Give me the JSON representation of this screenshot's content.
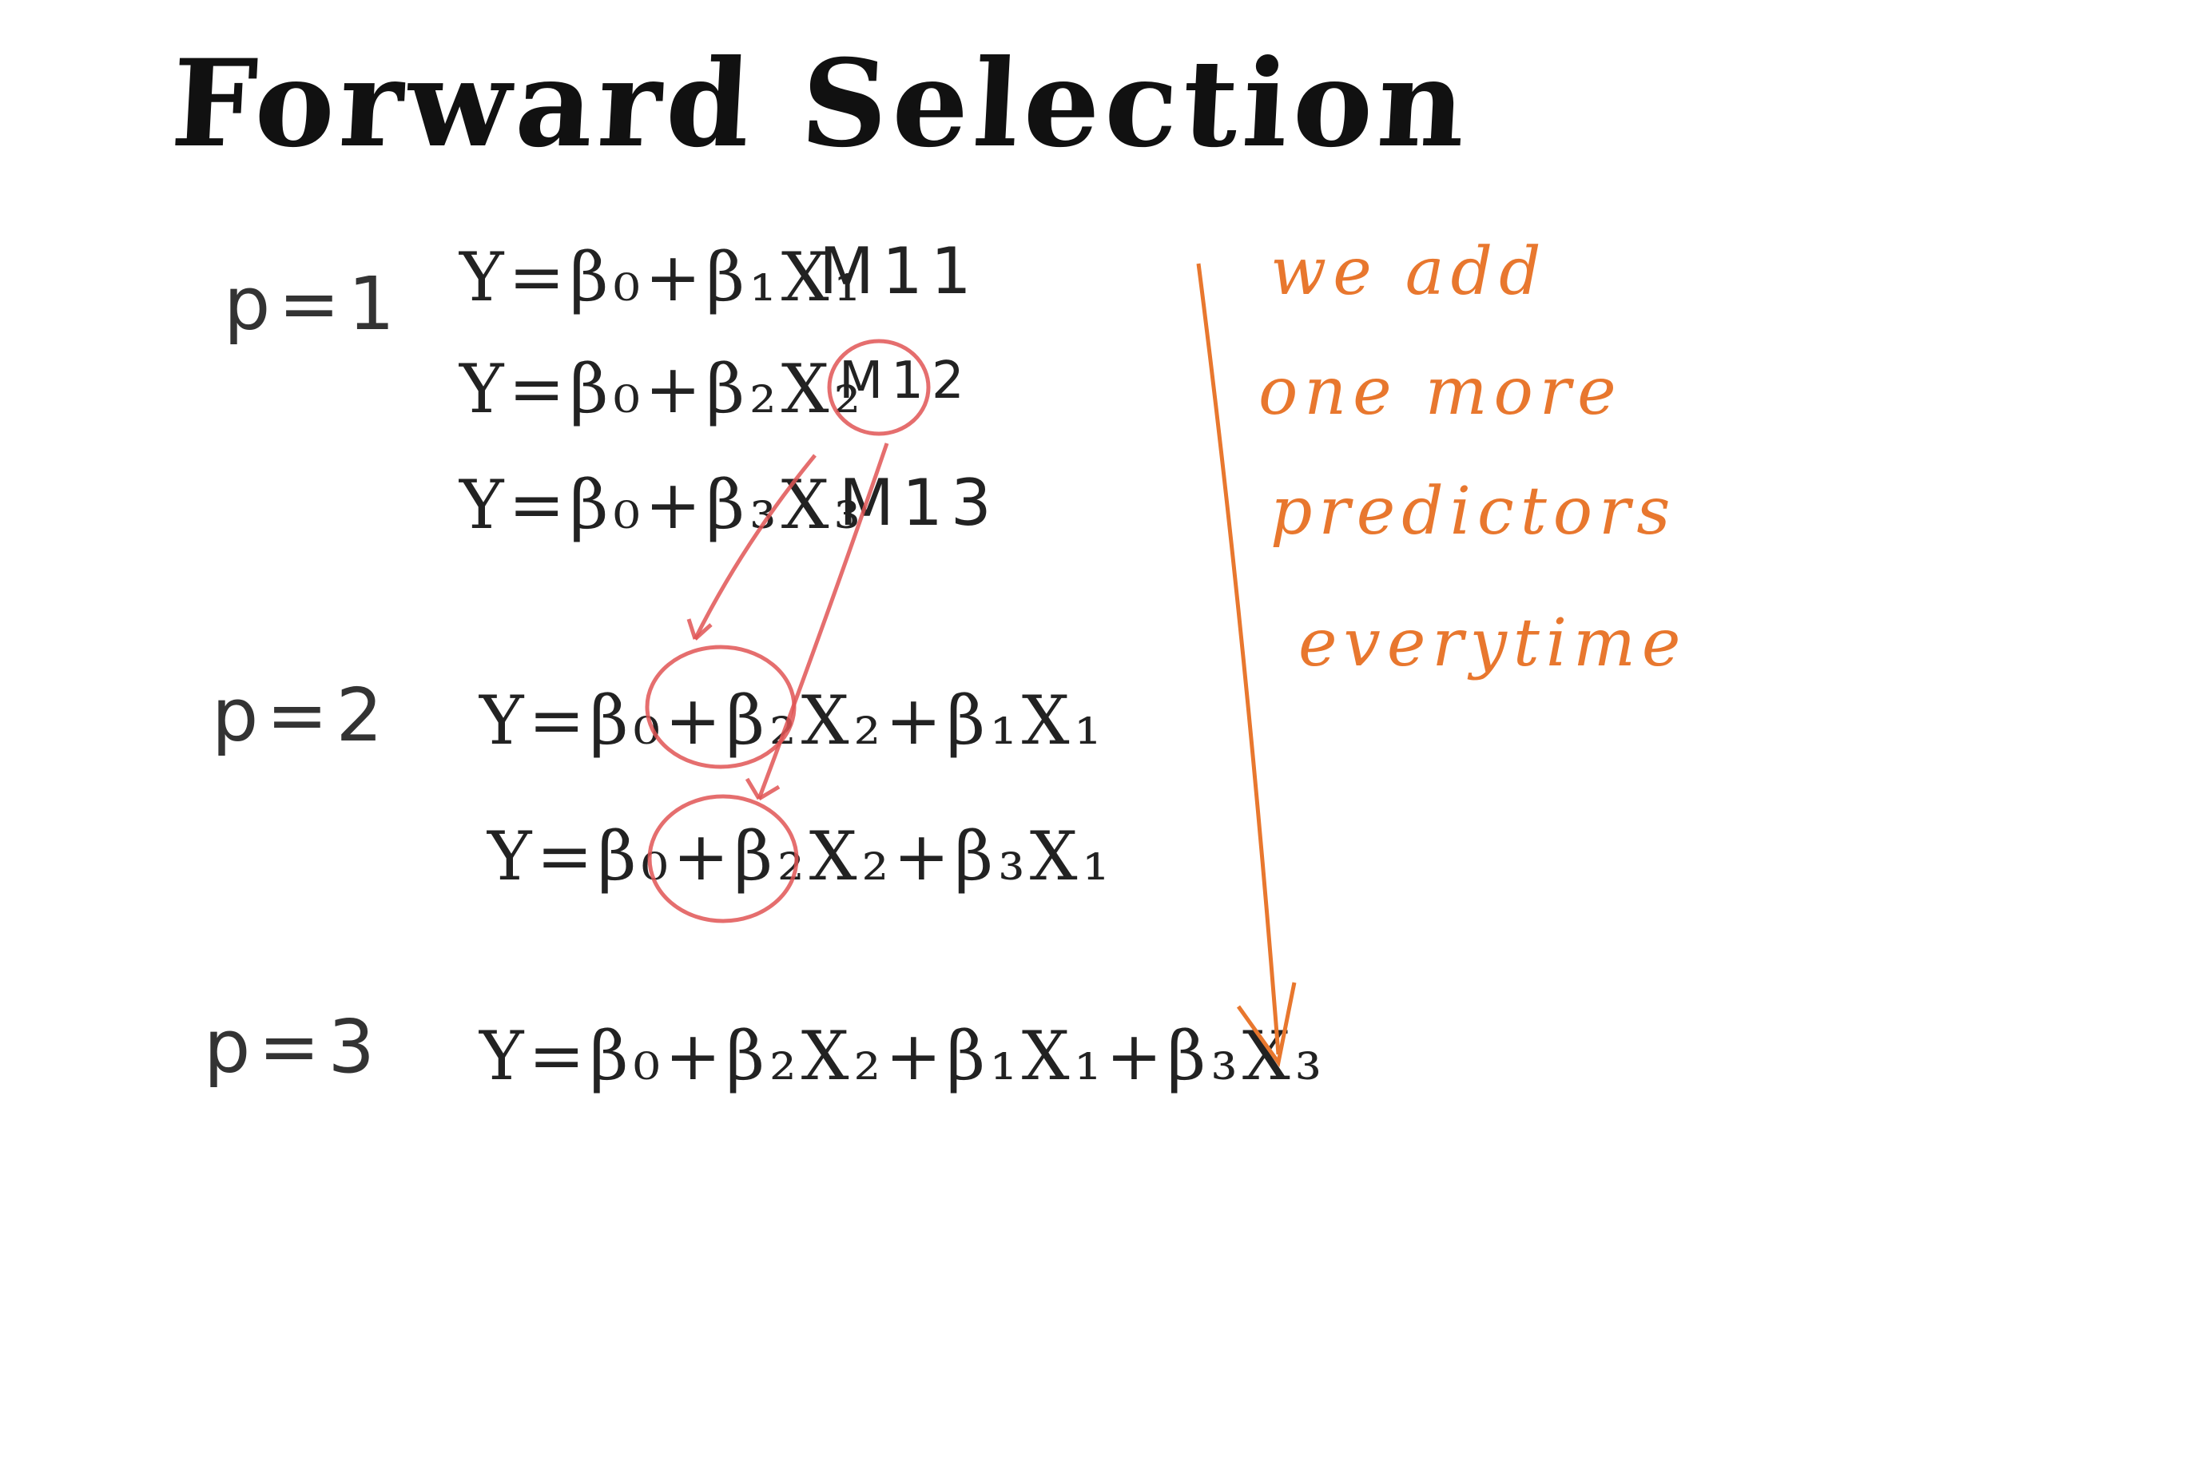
{
  "title": "Forward Selection",
  "rows": [
    {
      "p_label": "p=1",
      "equations": [
        {
          "text": "Y=β₀+β₁X₁",
          "model": "M11"
        },
        {
          "text": "Y=β₀+β₂X₂",
          "model": "M12"
        },
        {
          "text": "Y=β₀+β₃X₃",
          "model": "M13"
        }
      ]
    },
    {
      "p_label": "p=2",
      "equations": [
        {
          "text": "Y=β₀+β₂X₂+β₁X₁"
        },
        {
          "text": "Y=β₀+β₂X₂+β₃X₁"
        }
      ]
    },
    {
      "p_label": "p=3",
      "equations": [
        {
          "text": "Y=β₀+β₂X₂+β₁X₁+β₃X₃"
        }
      ]
    }
  ],
  "note": {
    "lines": [
      "we add",
      "one more",
      "predictors",
      "everytime"
    ]
  },
  "colors": {
    "ink": "#222222",
    "highlight": "#e05555",
    "note": "#e8772e"
  }
}
